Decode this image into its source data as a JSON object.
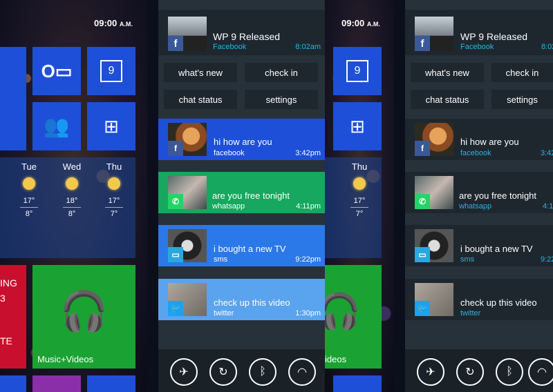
{
  "clock": {
    "time": "09:00",
    "ampm": "A.M."
  },
  "calendar_day": "9",
  "weather": {
    "days": [
      {
        "name": "Tue",
        "high": "17°",
        "low": "8°"
      },
      {
        "name": "Wed",
        "high": "18°",
        "low": "8°"
      },
      {
        "name": "Thu",
        "high": "17°",
        "low": "7°"
      }
    ]
  },
  "tiles": {
    "music_label": "Music+Videos",
    "red_partial_1": "ING",
    "red_partial_2": "3",
    "red_partial_3": "TE",
    "music_partial": "ideos"
  },
  "header": {
    "title": "WP 9 Released",
    "source": "Facebook",
    "time": "8:02am"
  },
  "buttons": {
    "whats_new": "what's new",
    "check_in": "check in",
    "chat_status": "chat status",
    "settings": "settings"
  },
  "notifications": [
    {
      "message": "hi how are you",
      "source": "facebook",
      "time": "3:42pm",
      "time_partial": "3:42",
      "color": "#1e4fd8",
      "badge": "f"
    },
    {
      "message": "are you free tonight",
      "source": "whatsapp",
      "time": "4:11pm",
      "time_partial": "4:1",
      "color": "#15a85e",
      "badge": "W"
    },
    {
      "message": "i bought a new TV",
      "source": "sms",
      "time": "9:22pm",
      "time_partial": "9:22",
      "color": "#2b78e8",
      "badge": "✉"
    },
    {
      "message": "check up this video",
      "source": "twitter",
      "time": "1:30pm",
      "time_partial": "",
      "color": "#5aa3ee",
      "badge": "t"
    }
  ],
  "toolbar": {
    "icons": [
      "airplane-icon",
      "rotate-icon",
      "bluetooth-icon",
      "wifi-icon"
    ]
  },
  "colors": {
    "accent": "#28b4e6",
    "panel": "#27313a",
    "tile_blue": "#1e4fd8",
    "tile_green": "#1aa332",
    "tile_red": "#c8102e"
  }
}
